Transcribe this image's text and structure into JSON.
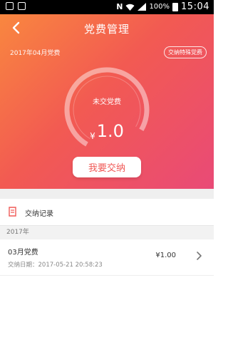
{
  "status_bar": {
    "battery": "100%",
    "time": "15:04",
    "network_label": "N"
  },
  "header": {
    "title": "党费管理"
  },
  "summary": {
    "month_label": "2017年04月党费",
    "special_button": "交纳特殊党费",
    "gauge_label": "未交党费",
    "currency": "¥",
    "amount": "1.0",
    "pay_button": "我要交纳"
  },
  "records": {
    "section_title": "交纳记录",
    "year": "2017年",
    "items": [
      {
        "title": "03月党费",
        "date": "交纳日期：2017-05-21 20:58:23",
        "amount": "¥1.00"
      }
    ]
  },
  "colors": {
    "gradient_start": "#f9873f",
    "gradient_mid": "#f25a52",
    "gradient_end": "#e94a77",
    "accent_text": "#f05a57"
  }
}
